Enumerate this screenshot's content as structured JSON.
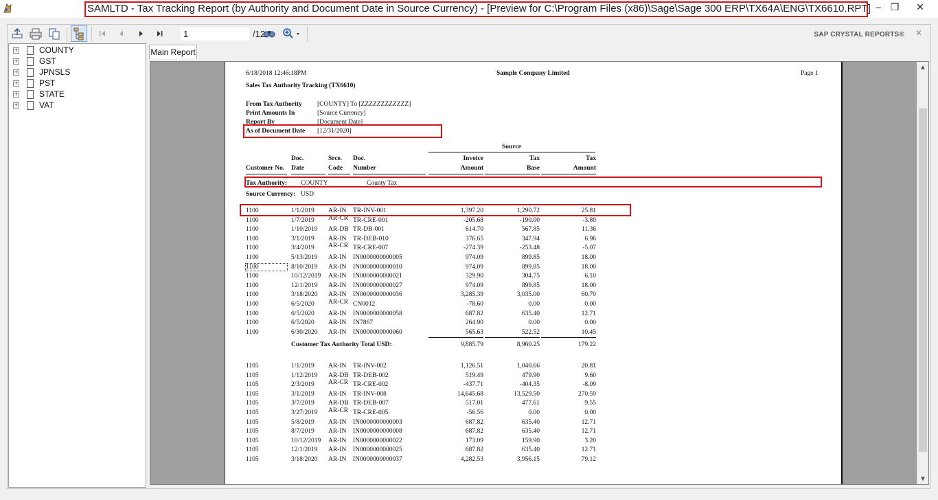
{
  "window": {
    "title": "SAMLTD - Tax Tracking Report (by Authority and Document Date in Source Currency) - [Preview for C:\\Program Files (x86)\\Sage\\Sage 300 ERP\\TX64A\\ENG\\TX6610.RPT]",
    "minimize": "–",
    "restore": "❐",
    "close": "✕"
  },
  "toolbar": {
    "page_value": "1",
    "page_total": "/12",
    "brand": "SAP CRYSTAL REPORTS®",
    "close": "✕"
  },
  "tree": {
    "items": [
      {
        "label": "COUNTY"
      },
      {
        "label": "GST"
      },
      {
        "label": "JPNSLS"
      },
      {
        "label": "PST"
      },
      {
        "label": "STATE"
      },
      {
        "label": "VAT"
      }
    ]
  },
  "tabs": {
    "main_report": "Main Report"
  },
  "report": {
    "date_time": "6/18/2018 12:46:18PM",
    "company": "Sample Company Limited",
    "page": "Page 1",
    "report_title": "Sales Tax Authority Tracking (TX6610)",
    "params": [
      {
        "label": "From Tax Authority",
        "value": "[COUNTY] To [ZZZZZZZZZZZZ]"
      },
      {
        "label": "Print Amounts In",
        "value": "[Source Currency]"
      },
      {
        "label": "Report By",
        "value": "[Document Date]"
      },
      {
        "label": "As of Document Date",
        "value": "[12/31/2020]"
      }
    ],
    "headers": {
      "source": "Source",
      "customer_no": "Customer No.",
      "doc_date_1": "Doc.",
      "doc_date_2": "Date",
      "srce_code_1": "Srce.",
      "srce_code_2": "Code",
      "doc_number_1": "Doc.",
      "doc_number_2": "Number",
      "invoice_amount_1": "Invoice",
      "invoice_amount_2": "Amount",
      "tax_base_1": "Tax",
      "tax_base_2": "Base",
      "tax_amount_1": "Tax",
      "tax_amount_2": "Amount"
    },
    "tax_authority_label": "Tax Authority:",
    "tax_authority_code": "COUNTY",
    "tax_authority_name": "County Tax",
    "source_currency_label": "Source Currency:",
    "source_currency": "USD",
    "group1": [
      {
        "cust": "1100",
        "date": "1/1/2019",
        "code": "AR-IN",
        "num": "TR-INV-001",
        "inv": "1,397.20",
        "base": "1,290.72",
        "tax": "25.81"
      },
      {
        "cust": "1100",
        "date": "1/7/2019",
        "code": "AR-CR",
        "num": "TR-CRE-001",
        "inv": "-205.68",
        "base": "-190.00",
        "tax": "-3.80"
      },
      {
        "cust": "1100",
        "date": "1/10/2019",
        "code": "AR-DB",
        "num": "TR-DB-001",
        "inv": "614.70",
        "base": "567.85",
        "tax": "11.36"
      },
      {
        "cust": "1100",
        "date": "3/1/2019",
        "code": "AR-IN",
        "num": "TR-DEB-010",
        "inv": "376.65",
        "base": "347.94",
        "tax": "6.96"
      },
      {
        "cust": "1100",
        "date": "3/4/2019",
        "code": "AR-CR",
        "num": "TR-CRE-007",
        "inv": "-274.39",
        "base": "-253.48",
        "tax": "-5.07"
      },
      {
        "cust": "1100",
        "date": "5/13/2019",
        "code": "AR-IN",
        "num": "IN0000000000005",
        "inv": "974.09",
        "base": "899.85",
        "tax": "18.00"
      },
      {
        "cust": "1100",
        "date": "8/10/2019",
        "code": "AR-IN",
        "num": "IN0000000000010",
        "inv": "974.09",
        "base": "899.85",
        "tax": "18.00"
      },
      {
        "cust": "1100",
        "date": "10/12/2019",
        "code": "AR-IN",
        "num": "IN0000000000021",
        "inv": "329.90",
        "base": "304.75",
        "tax": "6.10"
      },
      {
        "cust": "1100",
        "date": "12/1/2019",
        "code": "AR-IN",
        "num": "IN0000000000027",
        "inv": "974.09",
        "base": "899.85",
        "tax": "18.00"
      },
      {
        "cust": "1100",
        "date": "3/18/2020",
        "code": "AR-IN",
        "num": "IN0000000000036",
        "inv": "3,285.39",
        "base": "3,035.00",
        "tax": "60.70"
      },
      {
        "cust": "1100",
        "date": "6/5/2020",
        "code": "AR-CR",
        "num": "CN0012",
        "inv": "-78.60",
        "base": "0.00",
        "tax": "0.00"
      },
      {
        "cust": "1100",
        "date": "6/5/2020",
        "code": "AR-IN",
        "num": "IN0000000000058",
        "inv": "687.82",
        "base": "635.40",
        "tax": "12.71"
      },
      {
        "cust": "1100",
        "date": "6/5/2020",
        "code": "AR-IN",
        "num": "IN7867",
        "inv": "264.90",
        "base": "0.00",
        "tax": "0.00"
      },
      {
        "cust": "1100",
        "date": "6/30/2020",
        "code": "AR-IN",
        "num": "IN0000000000060",
        "inv": "565.63",
        "base": "522.52",
        "tax": "10.45"
      }
    ],
    "group1_total_label": "Customer Tax Authority Total USD:",
    "group1_total": {
      "inv": "9,885.79",
      "base": "8,960.25",
      "tax": "179.22"
    },
    "group2": [
      {
        "cust": "1105",
        "date": "1/1/2019",
        "code": "AR-IN",
        "num": "TR-INV-002",
        "inv": "1,126.51",
        "base": "1,040.66",
        "tax": "20.81"
      },
      {
        "cust": "1105",
        "date": "1/12/2019",
        "code": "AR-DB",
        "num": "TR-DEB-002",
        "inv": "519.49",
        "base": "479.90",
        "tax": "9.60"
      },
      {
        "cust": "1105",
        "date": "2/3/2019",
        "code": "AR-CR",
        "num": "TR-CRE-002",
        "inv": "-437.71",
        "base": "-404.35",
        "tax": "-8.09"
      },
      {
        "cust": "1105",
        "date": "3/1/2019",
        "code": "AR-IN",
        "num": "TR-INV-008",
        "inv": "14,645.68",
        "base": "13,529.50",
        "tax": "270.59"
      },
      {
        "cust": "1105",
        "date": "3/7/2019",
        "code": "AR-DB",
        "num": "TR-DEB-007",
        "inv": "517.01",
        "base": "477.61",
        "tax": "9.55"
      },
      {
        "cust": "1105",
        "date": "3/27/2019",
        "code": "AR-CR",
        "num": "TR-CRE-005",
        "inv": "-56.56",
        "base": "0.00",
        "tax": "0.00"
      },
      {
        "cust": "1105",
        "date": "5/8/2019",
        "code": "AR-IN",
        "num": "IN0000000000003",
        "inv": "687.82",
        "base": "635.40",
        "tax": "12.71"
      },
      {
        "cust": "1105",
        "date": "8/7/2019",
        "code": "AR-IN",
        "num": "IN0000000000008",
        "inv": "687.82",
        "base": "635.40",
        "tax": "12.71"
      },
      {
        "cust": "1105",
        "date": "10/12/2019",
        "code": "AR-IN",
        "num": "IN0000000000022",
        "inv": "173.09",
        "base": "159.90",
        "tax": "3.20"
      },
      {
        "cust": "1105",
        "date": "12/1/2019",
        "code": "AR-IN",
        "num": "IN0000000000025",
        "inv": "687.82",
        "base": "635.40",
        "tax": "12.71"
      },
      {
        "cust": "1105",
        "date": "3/18/2020",
        "code": "AR-IN",
        "num": "IN0000000000037",
        "inv": "4,282.53",
        "base": "3,956.15",
        "tax": "79.12"
      }
    ]
  }
}
